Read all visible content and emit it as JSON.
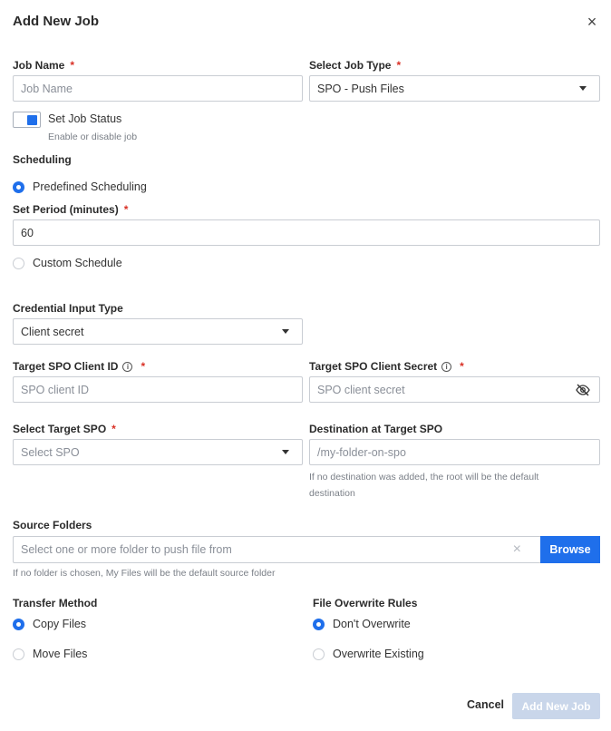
{
  "dialog": {
    "title": "Add New Job",
    "close": "×"
  },
  "job_name": {
    "label": "Job Name",
    "required": "*",
    "placeholder": "Job Name",
    "value": ""
  },
  "job_type": {
    "label": "Select Job Type",
    "required": "*",
    "value": "SPO - Push Files"
  },
  "job_status": {
    "label": "Set Job Status",
    "hint": "Enable or disable job",
    "enabled": true
  },
  "scheduling": {
    "label": "Scheduling",
    "predefined_label": "Predefined Scheduling",
    "period_label": "Set Period (minutes)",
    "period_required": "*",
    "period_value": "60",
    "custom_label": "Custom Schedule",
    "selected": "predefined"
  },
  "credential": {
    "label": "Credential Input Type",
    "value": "Client secret"
  },
  "client_id": {
    "label": "Target SPO Client ID",
    "required": "*",
    "placeholder": "SPO client ID"
  },
  "client_secret": {
    "label": "Target SPO Client Secret",
    "required": "*",
    "placeholder": "SPO client secret"
  },
  "target_spo": {
    "label": "Select Target SPO",
    "required": "*",
    "placeholder": "Select SPO"
  },
  "destination": {
    "label": "Destination at Target SPO",
    "placeholder": "/my-folder-on-spo",
    "hint_line1": "If no destination was added, the root will be the default",
    "hint_line2": "destination"
  },
  "source_folders": {
    "label": "Source Folders",
    "placeholder": "Select one or more folder to push file from",
    "clear": "×",
    "browse_label": "Browse",
    "hint": "If no folder is chosen, My Files will be the default source folder"
  },
  "transfer": {
    "label": "Transfer Method",
    "option1": "Copy Files",
    "option2": "Move Files",
    "selected": "copy"
  },
  "overwrite": {
    "label": "File Overwrite Rules",
    "option1": "Don't Overwrite",
    "option2": "Overwrite Existing",
    "selected": "dont"
  },
  "footer": {
    "cancel": "Cancel",
    "submit": "Add New Job"
  },
  "colors": {
    "accent": "#1f6feb",
    "required": "#d93025",
    "disabled_button": "#c9d6ea"
  }
}
